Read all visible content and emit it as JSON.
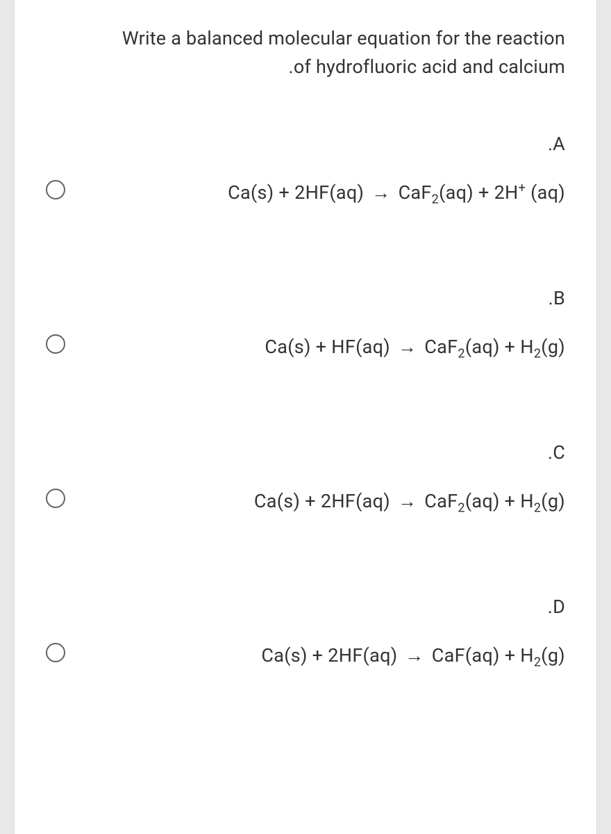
{
  "question": {
    "line1": "Write a balanced molecular equation for the reaction",
    "line2": ".of hydrofluoric acid and calcium"
  },
  "options": {
    "a": {
      "letter": ".A",
      "eq_left1": "Ca(s) + 2HF(aq)",
      "arrow": "→",
      "eq_right_prefix": "CaF",
      "eq_right_sub1": "2",
      "eq_right_mid": "(aq) + 2H",
      "eq_right_sup": "+",
      "eq_right_suffix": " (aq)"
    },
    "b": {
      "letter": ".B",
      "eq_left1": "Ca(s) + HF(aq)",
      "arrow": "→",
      "eq_right_prefix": "CaF",
      "eq_right_sub1": "2",
      "eq_right_mid": "(aq) + H",
      "eq_right_sub2": "2",
      "eq_right_suffix": "(g)"
    },
    "c": {
      "letter": ".C",
      "eq_left1": "Ca(s) + 2HF(aq)",
      "arrow": "→",
      "eq_right_prefix": "CaF",
      "eq_right_sub1": "2",
      "eq_right_mid": "(aq) + H",
      "eq_right_sub2": "2",
      "eq_right_suffix": "(g)"
    },
    "d": {
      "letter": ".D",
      "eq_left1": "Ca(s) + 2HF(aq)",
      "arrow": "→",
      "eq_right_prefix": "CaF(aq) + H",
      "eq_right_sub2": "2",
      "eq_right_suffix": "(g)"
    }
  }
}
